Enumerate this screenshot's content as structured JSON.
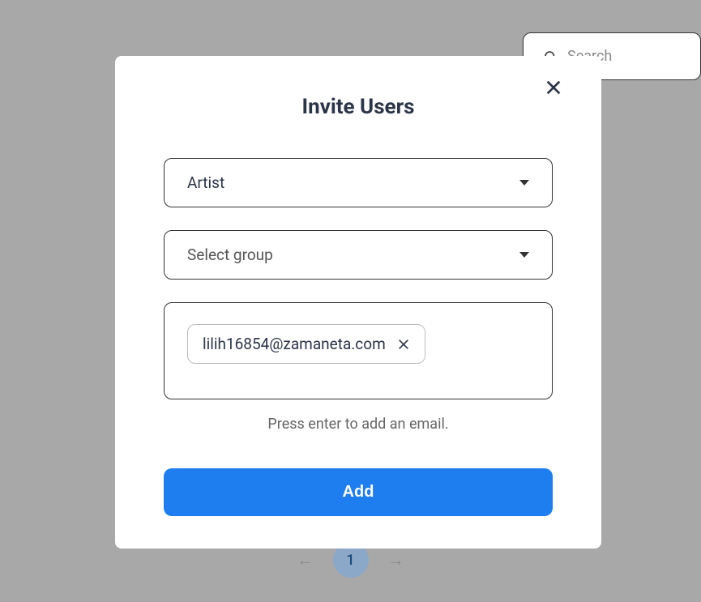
{
  "search": {
    "placeholder": "Search"
  },
  "modal": {
    "title": "Invite Users",
    "role_select": {
      "value": "Artist"
    },
    "group_select": {
      "placeholder": "Select group"
    },
    "emails": [
      "lilih16854@zamaneta.com"
    ],
    "helper_text": "Press enter to add an email.",
    "add_button_label": "Add"
  },
  "pagination": {
    "current": "1"
  }
}
